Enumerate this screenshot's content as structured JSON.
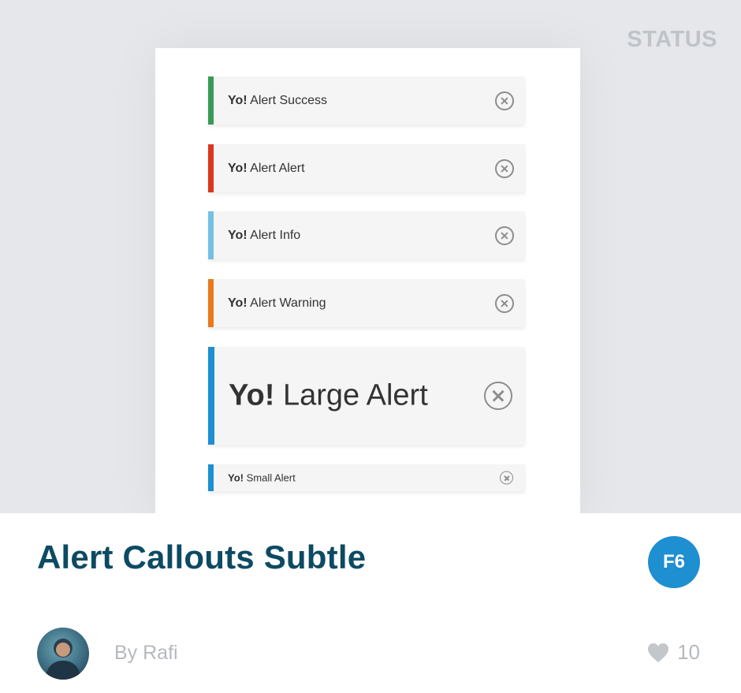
{
  "category": "STATUS",
  "preview": {
    "alerts": [
      {
        "bold": "Yo!",
        "text": " Alert Success",
        "size": "standard",
        "color": "#3a9a55"
      },
      {
        "bold": "Yo!",
        "text": " Alert Alert",
        "size": "standard",
        "color": "#d93820"
      },
      {
        "bold": "Yo!",
        "text": " Alert Info",
        "size": "standard",
        "color": "#77bfe3"
      },
      {
        "bold": "Yo!",
        "text": " Alert Warning",
        "size": "standard",
        "color": "#e8791d"
      },
      {
        "bold": "Yo!",
        "text": " Large Alert",
        "size": "large",
        "color": "#1e8fd0"
      },
      {
        "bold": "Yo!",
        "text": " Small Alert",
        "size": "small",
        "color": "#1e8fd0"
      }
    ],
    "close_icon": "close-circle-icon"
  },
  "card": {
    "title": "Alert Callouts Subtle",
    "badge": "F6",
    "author": "By Rafi",
    "likes": "10",
    "like_icon": "heart-icon",
    "colors": {
      "title": "#0d4a63",
      "badge": "#1e8fd0",
      "muted": "#b5b9be"
    }
  }
}
